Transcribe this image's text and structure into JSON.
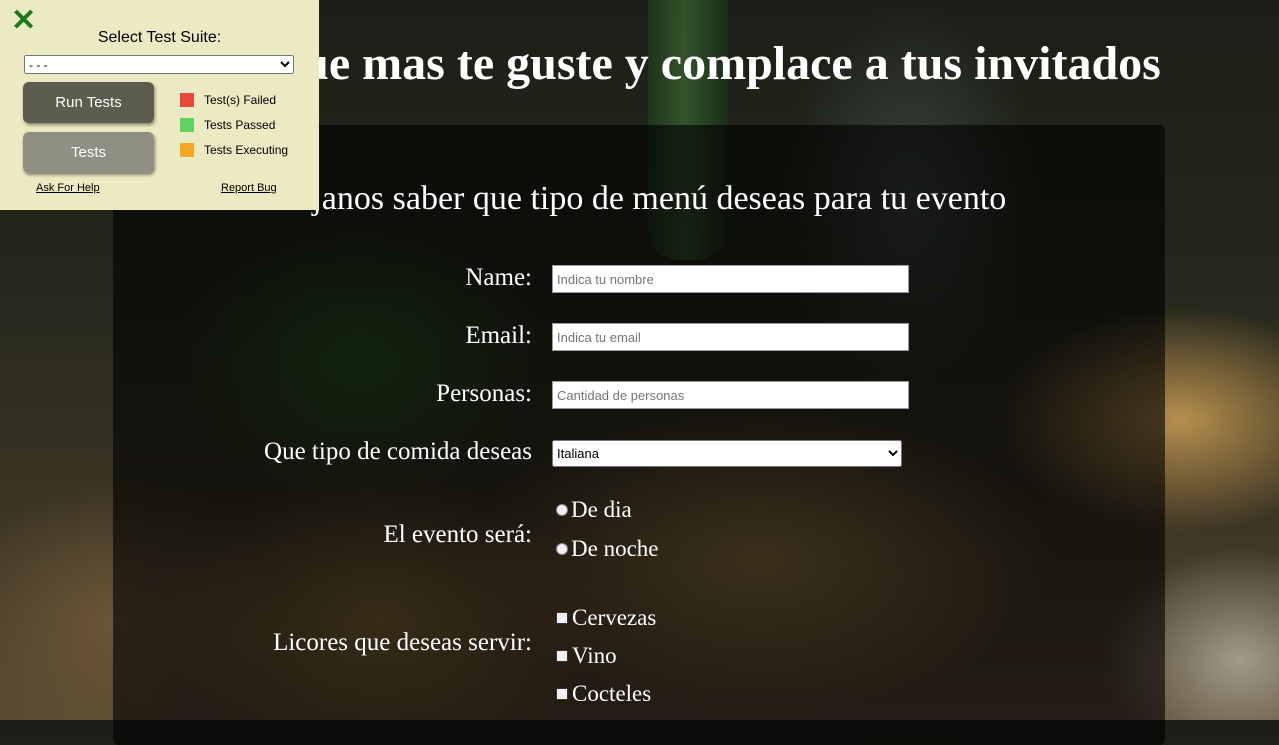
{
  "page": {
    "title": "Elije lo que mas te guste y complace a tus invitados",
    "subtitle": "Dejanos saber que tipo de menú deseas para tu evento"
  },
  "form": {
    "name_label": "Name:",
    "name_placeholder": "Indica tu nombre",
    "email_label": "Email:",
    "email_placeholder": "Indica tu email",
    "people_label": "Personas:",
    "people_placeholder": "Cantidad de personas",
    "food_label": "Que tipo de comida deseas",
    "food_selected": "Italiana",
    "event_label": "El evento será:",
    "event_options": [
      "De dia",
      "De noche"
    ],
    "liquor_label": "Licores que deseas servir:",
    "liquor_options": [
      "Cervezas",
      "Vino",
      "Cocteles"
    ]
  },
  "test_panel": {
    "suite_label": "Select Test Suite:",
    "suite_selected": "- - -",
    "run_button": "Run Tests",
    "tests_button": "Tests",
    "legend": [
      {
        "label": "Test(s) Failed",
        "color": "#e8473b"
      },
      {
        "label": "Tests Passed",
        "color": "#5fd35f"
      },
      {
        "label": "Tests Executing",
        "color": "#f5a623"
      }
    ],
    "help_link": "Ask For Help",
    "bug_link": "Report Bug"
  },
  "colors": {
    "panel_bg": "#ebeac3",
    "close_icon": "#1a7a1a"
  }
}
